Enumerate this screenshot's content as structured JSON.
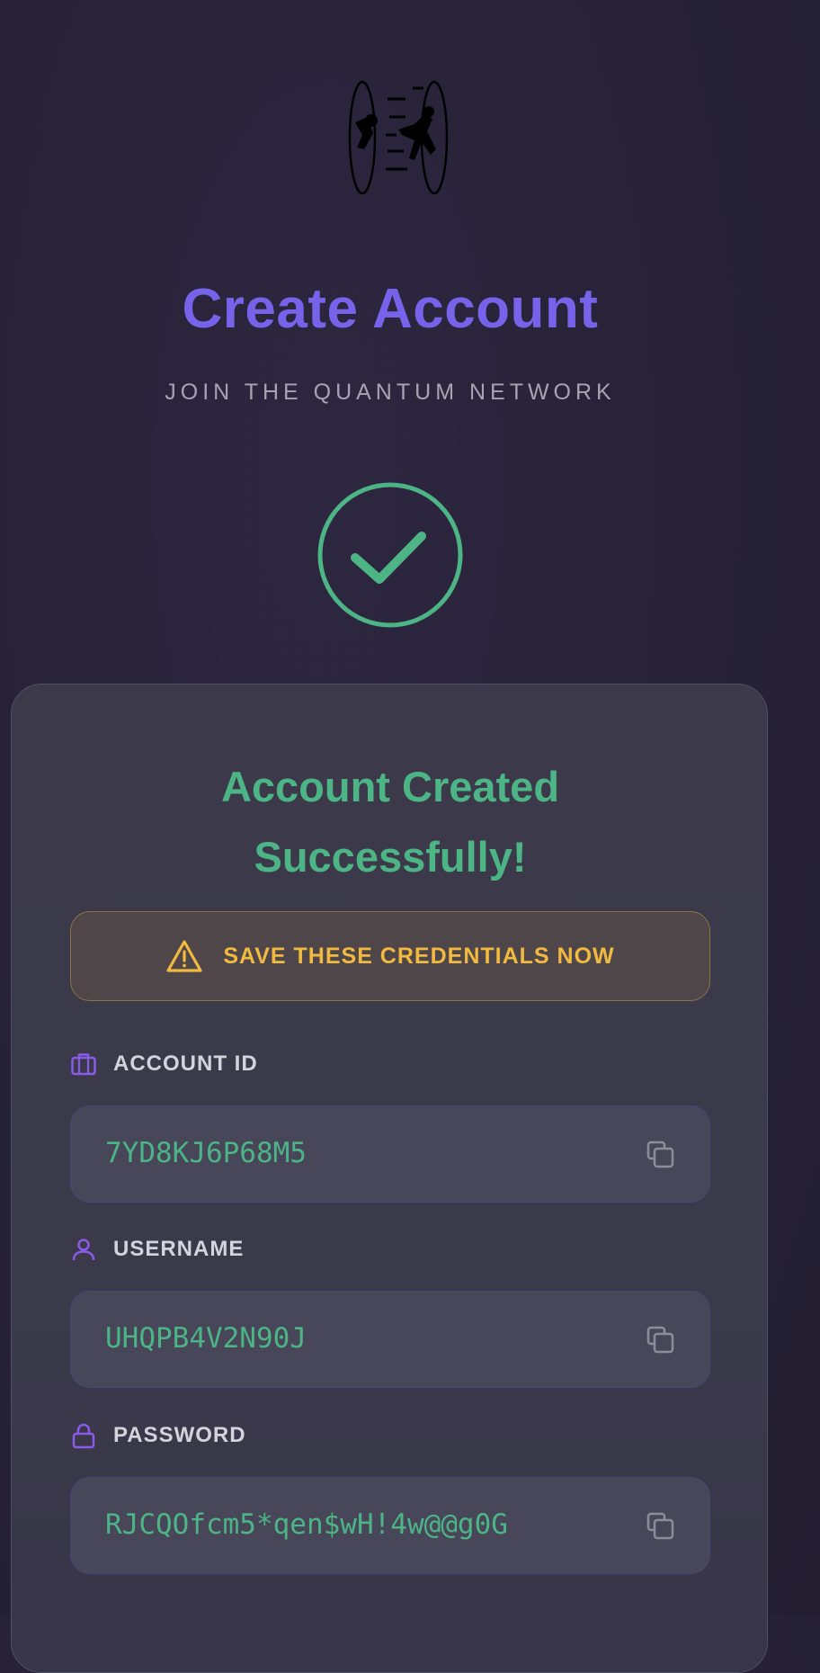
{
  "header": {
    "title": "Create Account",
    "subtitle": "JOIN THE QUANTUM NETWORK"
  },
  "logo_icon": "teleport-portal-icon",
  "status_icon": "check-circle-icon",
  "card": {
    "success_line1": "Account Created",
    "success_line2": "Successfully!",
    "warning": "SAVE THESE CREDENTIALS NOW",
    "fields": [
      {
        "label": "ACCOUNT ID",
        "value": "7YD8KJ6P68M5",
        "icon": "briefcase-icon"
      },
      {
        "label": "USERNAME",
        "value": "UHQPB4V2N90J",
        "icon": "user-icon"
      },
      {
        "label": "PASSWORD",
        "value": "RJCQOfcm5*qen$wH!4w@@g0G",
        "icon": "lock-icon"
      }
    ]
  },
  "colors": {
    "accent": "#7663ea",
    "success": "#4cb485",
    "warning": "#f1b940",
    "background": "#272236"
  }
}
